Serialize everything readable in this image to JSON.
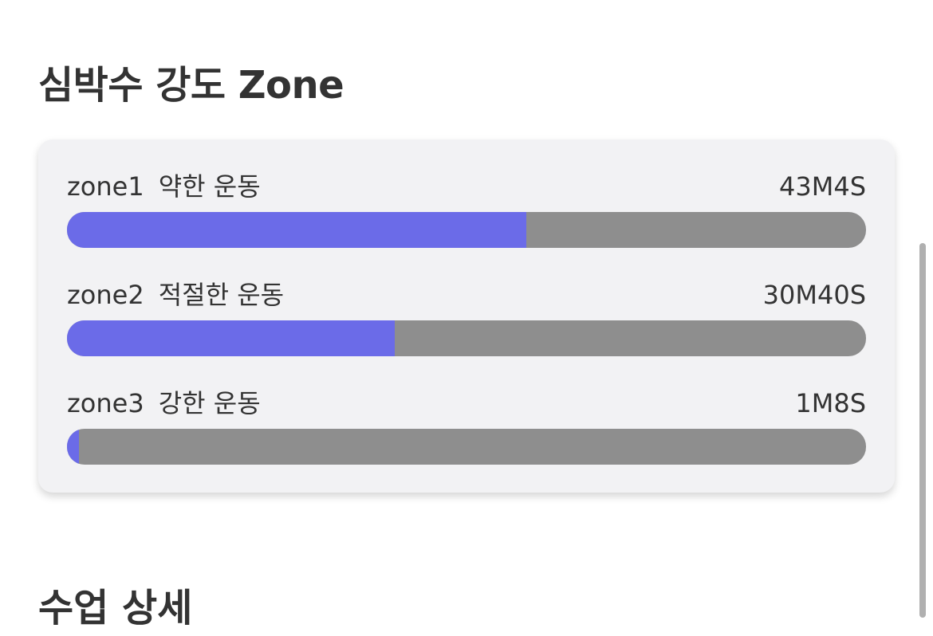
{
  "section_title": "심박수 강도 Zone",
  "zones": [
    {
      "name": "zone1",
      "description": "약한 운동",
      "duration": "43M4S",
      "fraction": 0.575
    },
    {
      "name": "zone2",
      "description": "적절한 운동",
      "duration": "30M40S",
      "fraction": 0.41
    },
    {
      "name": "zone3",
      "description": "강한 운동",
      "duration": "1M8S",
      "fraction": 0.015
    }
  ],
  "next_section_title": "수업 상세",
  "colors": {
    "bar_fill": "#6b6be8",
    "bar_track": "#8e8e8e",
    "card_background": "#f2f2f4",
    "text": "#333333"
  }
}
